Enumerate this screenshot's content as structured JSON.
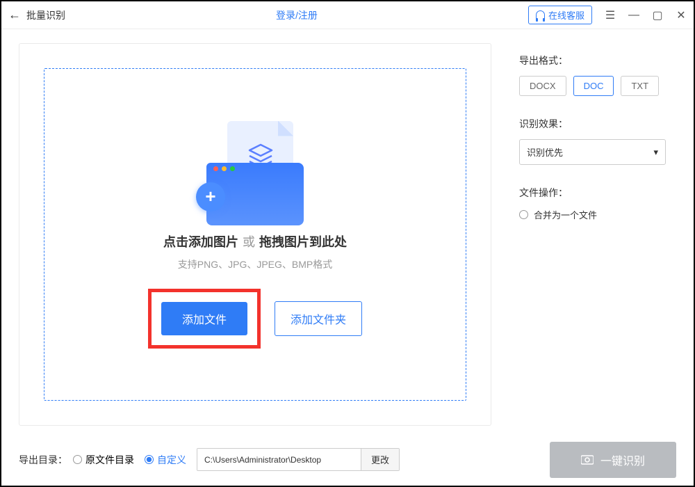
{
  "titlebar": {
    "title": "批量识别",
    "login": "登录/注册",
    "support": "在线客服"
  },
  "dropzone": {
    "line1_a": "点击添加图片",
    "line1_mid": "或",
    "line1_b": "拖拽图片到此处",
    "sub": "支持PNG、JPG、JPEG、BMP格式",
    "add_file": "添加文件",
    "add_folder": "添加文件夹"
  },
  "sidebar": {
    "export_format_label": "导出格式：",
    "formats": {
      "docx": "DOCX",
      "doc": "DOC",
      "txt": "TXT"
    },
    "selected_format": "DOC",
    "effect_label": "识别效果：",
    "effect_value": "识别优先",
    "file_op_label": "文件操作：",
    "merge_option": "合并为一个文件"
  },
  "footer": {
    "export_dir_label": "导出目录：",
    "original_dir": "原文件目录",
    "custom": "自定义",
    "path": "C:\\Users\\Administrator\\Desktop",
    "change": "更改",
    "recognize": "一键识别"
  }
}
